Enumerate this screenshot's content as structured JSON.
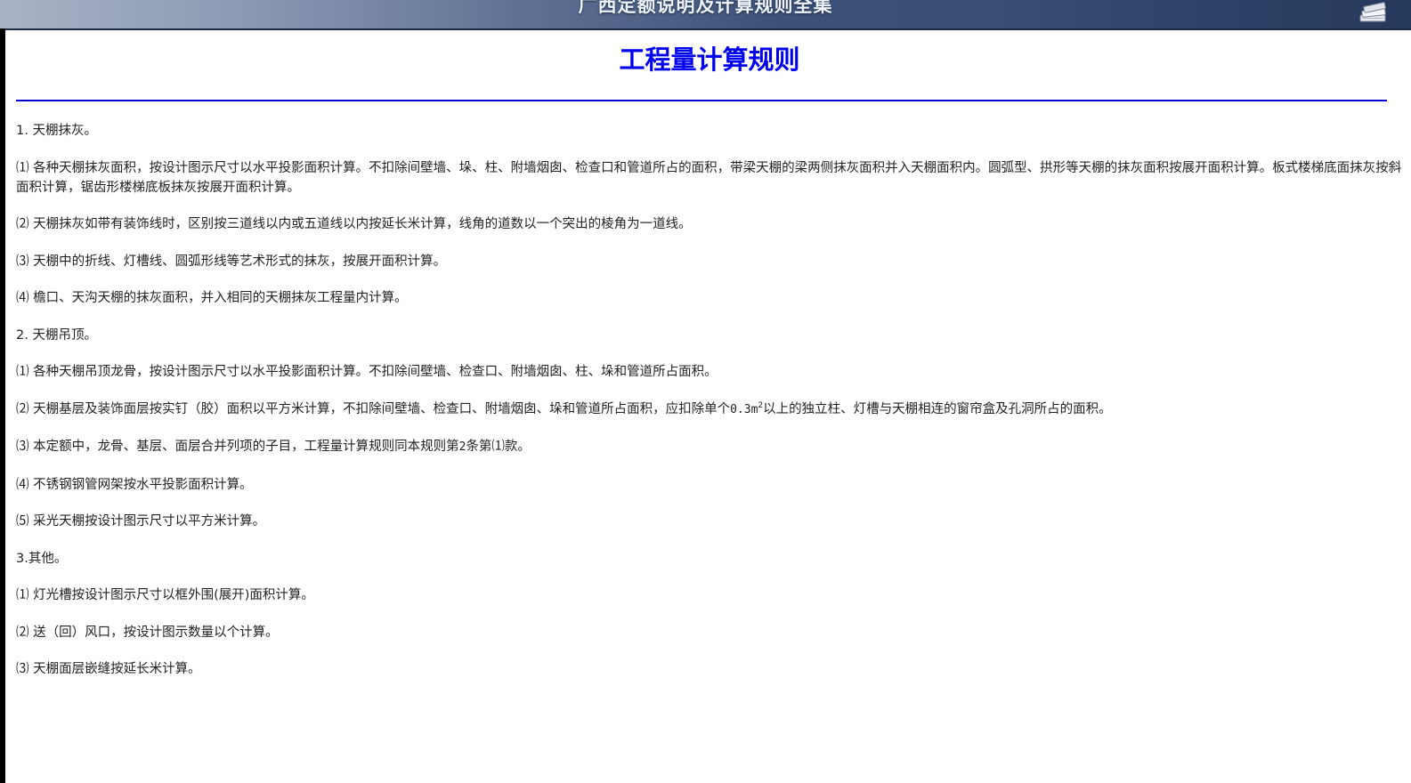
{
  "banner": {
    "title": "广西定额说明及计算规则全集",
    "icon": "books-stack-icon"
  },
  "page": {
    "title": "工程量计算规则"
  },
  "paragraphs": {
    "p1": "1. 天棚抹灰。",
    "p2": "⑴ 各种天棚抹灰面积，按设计图示尺寸以水平投影面积计算。不扣除间壁墙、垛、柱、附墙烟囱、检查口和管道所占的面积，带梁天棚的梁两侧抹灰面积并入天棚面积内。圆弧型、拱形等天棚的抹灰面积按展开面积计算。板式楼梯底面抹灰按斜面积计算，锯齿形楼梯底板抹灰按展开面积计算。",
    "p3": "⑵ 天棚抹灰如带有装饰线时，区别按三道线以内或五道线以内按延长米计算，线角的道数以一个突出的棱角为一道线。",
    "p4": "⑶ 天棚中的折线、灯槽线、圆弧形线等艺术形式的抹灰，按展开面积计算。",
    "p5": "⑷ 檐口、天沟天棚的抹灰面积，并入相同的天棚抹灰工程量内计算。",
    "p6": "2. 天棚吊顶。",
    "p7": "⑴ 各种天棚吊顶龙骨，按设计图示尺寸以水平投影面积计算。不扣除间壁墙、检查口、附墙烟囱、柱、垛和管道所占面积。",
    "p8_before": "⑵ 天棚基层及装饰面层按实钉（胶）面积以平方米计算，不扣除间壁墙、检查口、附墙烟囱、垛和管道所占面积，应扣除单个",
    "p8_value": "0.3m",
    "p8_sup": "2",
    "p8_after": "以上的独立柱、灯槽与天棚相连的窗帘盒及孔洞所占的面积。",
    "p9_before": "⑶ 本定额中，龙骨、基层、面层合并列项的子目，工程量计算规则同本规则第",
    "p9_num": "2",
    "p9_after": "条第⑴款。",
    "p10": "⑷ 不锈钢钢管网架按水平投影面积计算。",
    "p11": "⑸ 采光天棚按设计图示尺寸以平方米计算。",
    "p12": "3.其他。",
    "p13": "⑴ 灯光槽按设计图示尺寸以框外围(展开)面积计算。",
    "p14": "⑵ 送（回）风口，按设计图示数量以个计算。",
    "p15": "⑶ 天棚面层嵌缝按延长米计算。"
  },
  "colors": {
    "title": "#0000ee",
    "rule": "#0000cc",
    "text": "#222222"
  }
}
